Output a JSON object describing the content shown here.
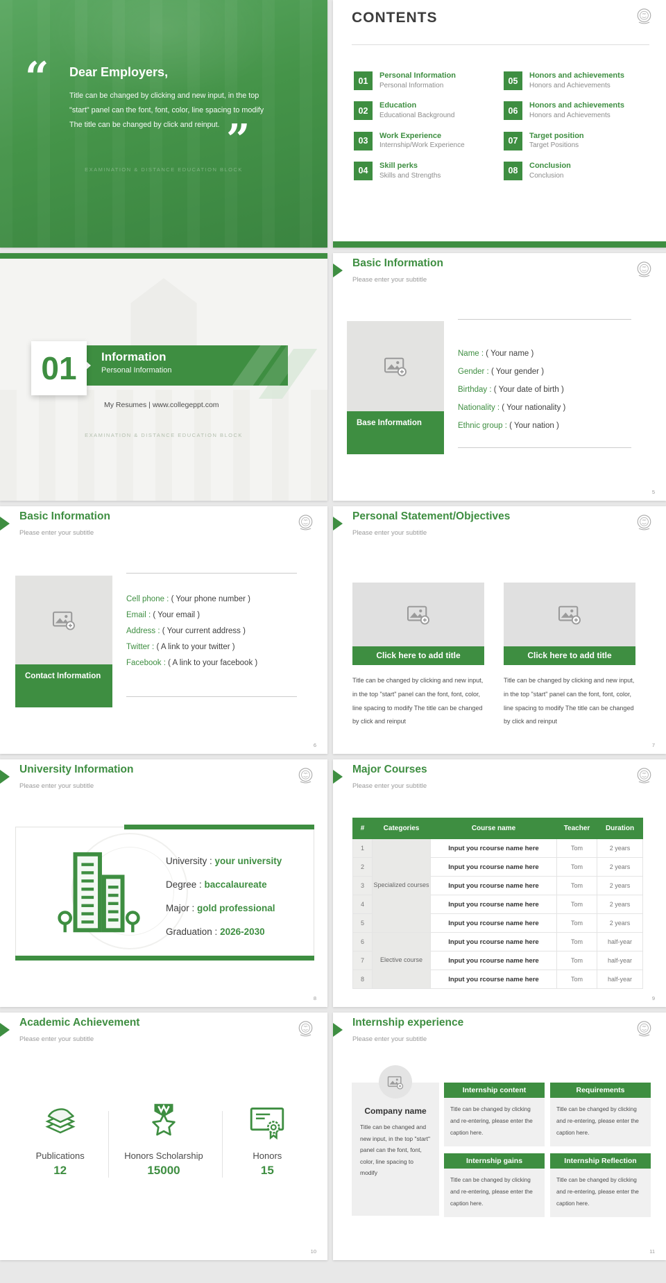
{
  "accent_color": "#3e8e41",
  "background_color": "#e8e8e8",
  "cover": {
    "open_quote": "“",
    "close_quote": "”",
    "title": "Dear Employers,",
    "body": "Title can be changed by clicking and new input, in the top \"start\" panel can the font, font, color, line spacing to modify The title can be changed by click and reinput.",
    "photo_caption": "EXAMINATION & DISTANCE EDUCATION BLOCK"
  },
  "contents": {
    "title": "CONTENTS",
    "items": [
      {
        "num": "01",
        "title": "Personal Information",
        "subtitle": "Personal Information"
      },
      {
        "num": "02",
        "title": "Education",
        "subtitle": "Educational Background"
      },
      {
        "num": "03",
        "title": "Work Experience",
        "subtitle": "Internship/Work Experience"
      },
      {
        "num": "04",
        "title": "Skill perks",
        "subtitle": "Skills and Strengths"
      },
      {
        "num": "05",
        "title": "Honors and achievements",
        "subtitle": "Honors and Achievements"
      },
      {
        "num": "06",
        "title": "Honors and achievements",
        "subtitle": "Honors and Achievements"
      },
      {
        "num": "07",
        "title": "Target position",
        "subtitle": "Target Positions"
      },
      {
        "num": "08",
        "title": "Conclusion",
        "subtitle": "Conclusion"
      }
    ]
  },
  "section": {
    "number": "01",
    "title": "Information",
    "subtitle": "Personal Information",
    "tagline": "My Resumes | www.collegeppt.com",
    "photo_caption": "EXAMINATION & DISTANCE EDUCATION BLOCK"
  },
  "basic_info": {
    "title": "Basic Information",
    "subtitle": "Please enter your subtitle",
    "image_label": "Base Information",
    "fields": [
      {
        "label": "Name :",
        "value": "( Your name )"
      },
      {
        "label": "Gender :",
        "value": "( Your gender )"
      },
      {
        "label": "Birthday :",
        "value": "( Your date of birth )"
      },
      {
        "label": "Nationality :",
        "value": "( Your nationality )"
      },
      {
        "label": "Ethnic group :",
        "value": "( Your nation )"
      }
    ],
    "page": "5"
  },
  "contact_info": {
    "title": "Basic Information",
    "subtitle": "Please enter your subtitle",
    "image_label": "Contact Information",
    "fields": [
      {
        "label": "Cell phone :",
        "value": "( Your phone number )"
      },
      {
        "label": "Email :",
        "value": "( Your email )"
      },
      {
        "label": "Address :",
        "value": "( Your current address )"
      },
      {
        "label": "Twitter :",
        "value": "( A link to your twitter )"
      },
      {
        "label": "Facebook :",
        "value": "(  A link to your facebook )"
      }
    ],
    "page": "6"
  },
  "statement": {
    "title": "Personal Statement/Objectives",
    "subtitle": "Please enter your subtitle",
    "cards": [
      {
        "title": "Click here to add title",
        "caption": "Title can be changed by clicking and new input, in the top \"start\" panel can the font, font, color, line spacing to modify The title can be changed by click and reinput"
      },
      {
        "title": "Click here to add title",
        "caption": "Title can be changed by clicking and new input, in the top \"start\" panel can the font, font, color, line spacing to modify The title can be changed by click and reinput"
      }
    ],
    "page": "7"
  },
  "university": {
    "title": "University Information",
    "subtitle": "Please enter your subtitle",
    "fields": [
      {
        "label": "University :",
        "value": "your university"
      },
      {
        "label": "Degree :",
        "value": "baccalaureate"
      },
      {
        "label": "Major :",
        "value": "gold professional"
      },
      {
        "label": "Graduation :",
        "value": "2026-2030"
      }
    ],
    "page": "8"
  },
  "major_courses": {
    "title": "Major Courses",
    "subtitle": "Please enter your subtitle",
    "headers": [
      "#",
      "Categories",
      "Course name",
      "Teacher",
      "Duration"
    ],
    "categories": [
      {
        "label": "Specialized courses"
      },
      {
        "label": "Elective course"
      }
    ],
    "rows": [
      {
        "num": "1",
        "course": "Input you rcourse name here",
        "teacher": "Tom",
        "duration": "2 years"
      },
      {
        "num": "2",
        "course": "Input you rcourse name here",
        "teacher": "Tom",
        "duration": "2 years"
      },
      {
        "num": "3",
        "course": "Input you rcourse name here",
        "teacher": "Tom",
        "duration": "2 years"
      },
      {
        "num": "4",
        "course": "Input you rcourse name here",
        "teacher": "Tom",
        "duration": "2 years"
      },
      {
        "num": "5",
        "course": "Input you rcourse name here",
        "teacher": "Tom",
        "duration": "2 years"
      },
      {
        "num": "6",
        "course": "Input you rcourse name here",
        "teacher": "Tom",
        "duration": "half-year"
      },
      {
        "num": "7",
        "course": "Input you rcourse name here",
        "teacher": "Tom",
        "duration": "half-year"
      },
      {
        "num": "8",
        "course": "Input you rcourse name here",
        "teacher": "Tom",
        "duration": "half-year"
      }
    ],
    "page": "9"
  },
  "achievement": {
    "title": "Academic Achievement",
    "subtitle": "Please enter your subtitle",
    "items": [
      {
        "label": "Publications",
        "value": "12"
      },
      {
        "label": "Honors Scholarship",
        "value": "15000"
      },
      {
        "label": "Honors",
        "value": "15"
      }
    ],
    "page": "10"
  },
  "internship": {
    "title": "Internship experience",
    "subtitle": "Please enter your subtitle",
    "company_name": "Company name",
    "company_caption": "Title can be changed and new input, in the top \"start\" panel can the font, font, color, line spacing to modify",
    "cards": [
      {
        "title": "Internship content",
        "caption": "Title can be changed by clicking and re-entering, please enter the caption here."
      },
      {
        "title": "Requirements",
        "caption": "Title can be changed by clicking and re-entering, please enter the caption here."
      },
      {
        "title": "Internship gains",
        "caption": "Title can be changed by clicking and re-entering, please enter the caption here."
      },
      {
        "title": "Internship Reflection",
        "caption": "Title can be changed by clicking and re-entering, please enter the caption here."
      }
    ],
    "page": "11"
  }
}
